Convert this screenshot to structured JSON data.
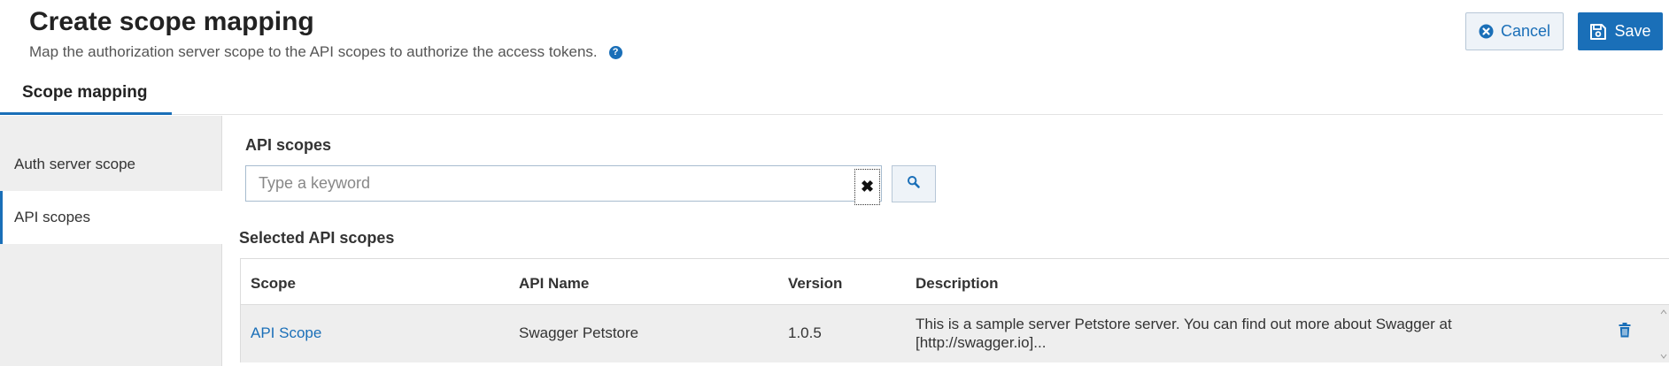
{
  "header": {
    "title": "Create scope mapping",
    "subtitle": "Map the authorization server scope to the API scopes to authorize the access tokens.",
    "help_icon": "?",
    "cancel_label": "Cancel",
    "save_label": "Save"
  },
  "tabs": [
    {
      "label": "Scope mapping",
      "active": true
    }
  ],
  "sidebar": {
    "items": [
      {
        "label": "Auth server scope",
        "active": false
      },
      {
        "label": "API scopes",
        "active": true
      }
    ]
  },
  "api_scopes": {
    "label": "API scopes",
    "search_placeholder": "Type a keyword",
    "search_value": "",
    "clear_glyph": "✖"
  },
  "selected": {
    "label": "Selected API scopes",
    "columns": [
      "Scope",
      "API Name",
      "Version",
      "Description"
    ],
    "rows": [
      {
        "scope": "API Scope",
        "api_name": "Swagger Petstore",
        "version": "1.0.5",
        "description": "This is a sample server Petstore server. You can find out more about Swagger at [http://swagger.io]..."
      }
    ]
  },
  "colors": {
    "accent": "#1a6fb8",
    "sidebar_bg": "#eeeeee",
    "row_bg": "#eeeeee"
  }
}
